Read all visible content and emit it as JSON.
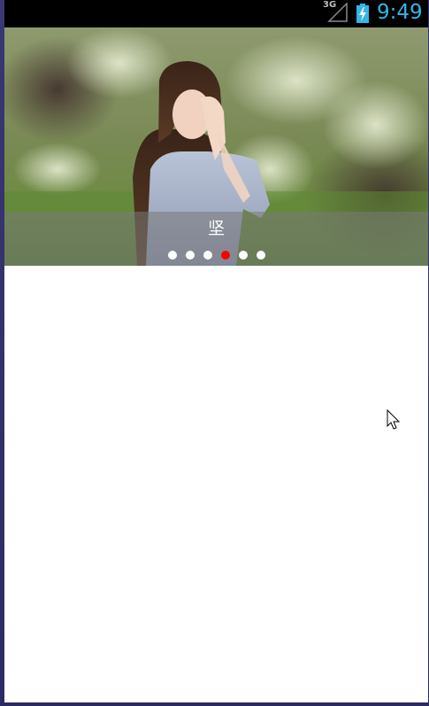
{
  "status_bar": {
    "network_type": "3G",
    "time": "9:49",
    "icons": [
      "signal-icon",
      "battery-charging-icon"
    ],
    "time_color": "#33b5e5"
  },
  "banner": {
    "caption": "坚",
    "indicator": {
      "count": 6,
      "active_index": 3,
      "active_color": "#ff0000",
      "inactive_color": "#ffffff"
    }
  },
  "pointer": {
    "icon": "mouse-pointer-icon"
  }
}
